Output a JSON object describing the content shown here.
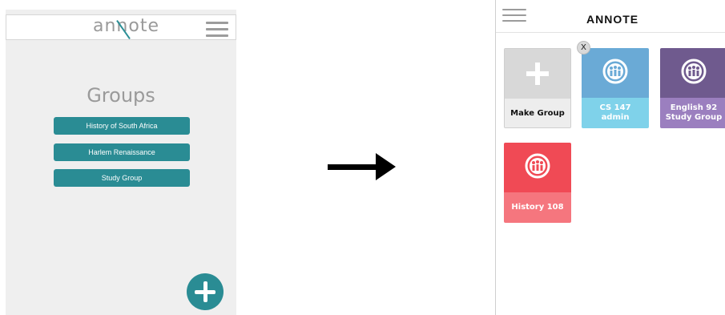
{
  "before": {
    "logo": "annote",
    "title": "Groups",
    "groups": [
      {
        "label": "History of South Africa"
      },
      {
        "label": "Harlem Renaissance"
      },
      {
        "label": "Study Group"
      }
    ],
    "add_icon": "plus-icon",
    "menu_icon": "hamburger-icon"
  },
  "after": {
    "app_title": "ANNOTE",
    "menu_icon": "hamburger-icon",
    "close_label": "X",
    "make_group_label": "Make Group",
    "tiles": [
      {
        "line1": "CS 147",
        "line2": "admin",
        "top_color": "#6aaad6",
        "bottom_color": "#7fd2ea"
      },
      {
        "line1": "English 92",
        "line2": "Study Group",
        "top_color": "#6f5a8e",
        "bottom_color": "#9b7fbf"
      },
      {
        "line1": "History 108",
        "line2": "",
        "top_color": "#f04a55",
        "bottom_color": "#f5767e"
      }
    ]
  },
  "colors": {
    "teal": "#2a8c94",
    "arrow": "#000000"
  }
}
